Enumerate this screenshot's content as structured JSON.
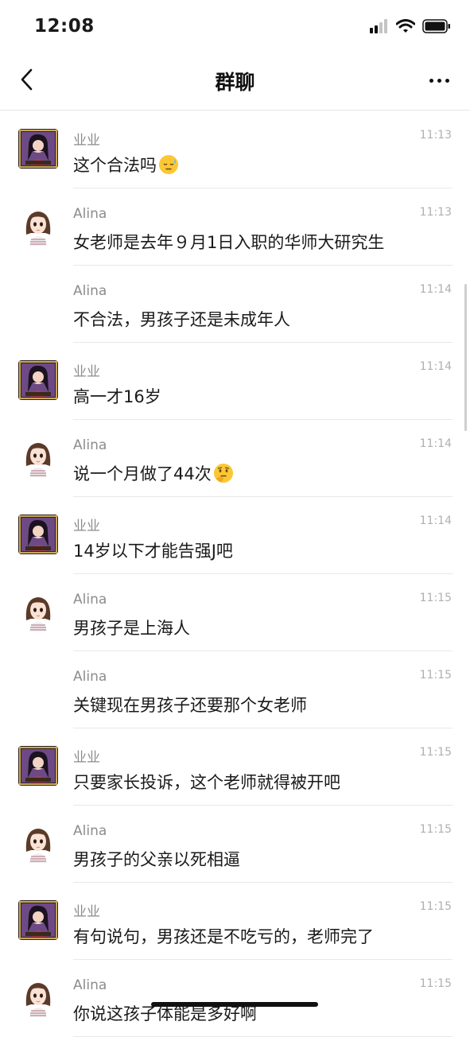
{
  "status_bar": {
    "time": "12:08"
  },
  "nav": {
    "title": "群聊"
  },
  "icons": {
    "back": "chevron-left-icon",
    "more": "more-horizontal-icon",
    "signal": "signal-icon",
    "wifi": "wifi-icon",
    "battery": "battery-icon"
  },
  "messages": [
    {
      "sender": "业业",
      "avatar": "anime-avatar",
      "time": "11:13",
      "text": "这个合法吗",
      "emoji": "sleepy-face"
    },
    {
      "sender": "Alina",
      "avatar": "girl-avatar",
      "time": "11:13",
      "text": "女老师是去年９月1日入职的华师大研究生"
    },
    {
      "sender": "Alina",
      "avatar": "",
      "time": "11:14",
      "text": "不合法，男孩子还是未成年人"
    },
    {
      "sender": "业业",
      "avatar": "anime-avatar",
      "time": "11:14",
      "text": "高一才16岁"
    },
    {
      "sender": "Alina",
      "avatar": "girl-avatar",
      "time": "11:14",
      "text": "说一个月做了44次",
      "emoji": "thinking-face"
    },
    {
      "sender": "业业",
      "avatar": "anime-avatar",
      "time": "11:14",
      "text": "14岁以下才能告强J吧"
    },
    {
      "sender": "Alina",
      "avatar": "girl-avatar",
      "time": "11:15",
      "text": "男孩子是上海人"
    },
    {
      "sender": "Alina",
      "avatar": "",
      "time": "11:15",
      "text": "关键现在男孩子还要那个女老师"
    },
    {
      "sender": "业业",
      "avatar": "anime-avatar",
      "time": "11:15",
      "text": "只要家长投诉，这个老师就得被开吧"
    },
    {
      "sender": "Alina",
      "avatar": "girl-avatar",
      "time": "11:15",
      "text": "男孩子的父亲以死相逼"
    },
    {
      "sender": "业业",
      "avatar": "anime-avatar",
      "time": "11:15",
      "text": "有句说句，男孩还是不吃亏的，老师完了"
    },
    {
      "sender": "Alina",
      "avatar": "girl-avatar",
      "time": "11:15",
      "text": "你说这孩子体能是多好啊"
    }
  ]
}
